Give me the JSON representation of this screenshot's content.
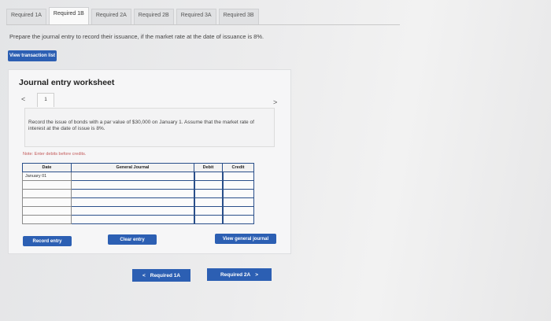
{
  "tabs": [
    "Required 1A",
    "Required 1B",
    "Required 2A",
    "Required 2B",
    "Required 3A",
    "Required 3B"
  ],
  "active_tab_index": 1,
  "prompt_text": "Prepare the journal entry to record their issuance, if the market rate at the date of issuance is 8%.",
  "view_transaction_label": "View transaction list",
  "worksheet": {
    "title": "Journal entry worksheet",
    "page_number": "1",
    "instruction": "Record the issue of bonds with a par value of $30,000 on January 1. Assume that the market rate of interest at the date of issue is 8%.",
    "note": "Note: Enter debits before credits."
  },
  "table": {
    "headers": {
      "date": "Date",
      "account": "General Journal",
      "debit": "Debit",
      "credit": "Credit"
    },
    "rows": [
      {
        "date": "January 01",
        "account": "",
        "debit": "",
        "credit": ""
      },
      {
        "date": "",
        "account": "",
        "debit": "",
        "credit": ""
      },
      {
        "date": "",
        "account": "",
        "debit": "",
        "credit": ""
      },
      {
        "date": "",
        "account": "",
        "debit": "",
        "credit": ""
      },
      {
        "date": "",
        "account": "",
        "debit": "",
        "credit": ""
      },
      {
        "date": "",
        "account": "",
        "debit": "",
        "credit": ""
      }
    ]
  },
  "buttons": {
    "record": "Record entry",
    "clear": "Clear entry",
    "view_general": "View general journal"
  },
  "nav": {
    "prev_label": "Required 1A",
    "next_label": "Required 2A"
  },
  "colors": {
    "accent_blue": "#2c5fb3",
    "note_red": "#c35a5a",
    "table_border": "#2a4f8a"
  }
}
